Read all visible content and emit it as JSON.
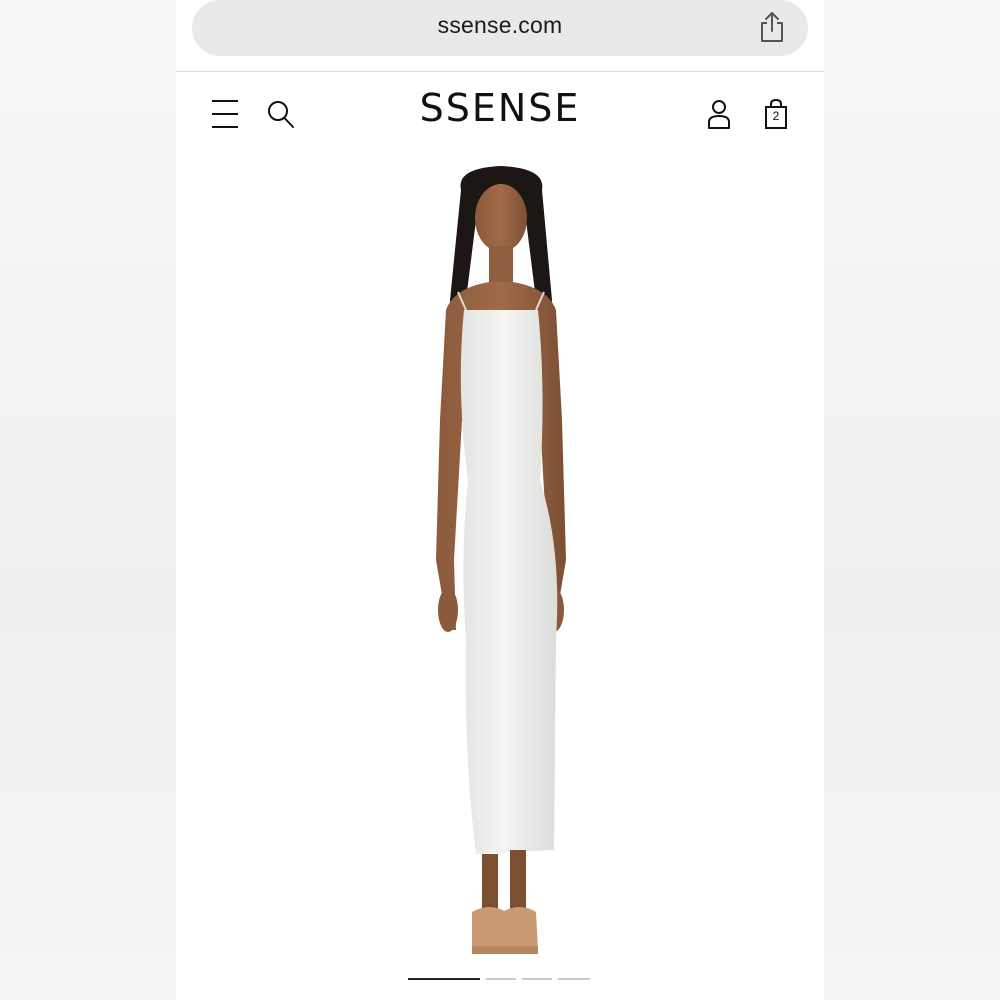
{
  "browser": {
    "url": "ssense.com",
    "share_icon": "share-icon"
  },
  "header": {
    "logo": "SSENSE",
    "menu_icon": "menu-icon",
    "search_icon": "search-icon",
    "account_icon": "user-icon",
    "bag_icon": "shopping-bag-icon",
    "bag_count": "2"
  },
  "product": {
    "image": "model-in-white-maxi-slip-dress"
  },
  "carousel": {
    "total": 4,
    "active_index": 0
  },
  "colors": {
    "urlbar_bg": "#e8e9eb",
    "text": "#111111",
    "indicator_active": "#222222",
    "indicator_inactive": "#c8c8c8"
  }
}
